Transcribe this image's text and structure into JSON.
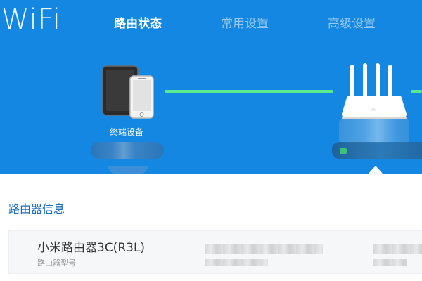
{
  "header": {
    "logo_text": "WiFi",
    "tabs": [
      {
        "label": "路由状态",
        "active": true
      },
      {
        "label": "常用设置",
        "active": false
      },
      {
        "label": "高级设置",
        "active": false
      }
    ]
  },
  "topology": {
    "device_label": "终端设备",
    "link_color": "#59e88e"
  },
  "router_info": {
    "section_title": "路由器信息",
    "model_value": "小米路由器3C(R3L)",
    "model_label": "路由器型号"
  },
  "colors": {
    "header_bg": "#1487e2",
    "accent_title": "#1a6fc0"
  }
}
